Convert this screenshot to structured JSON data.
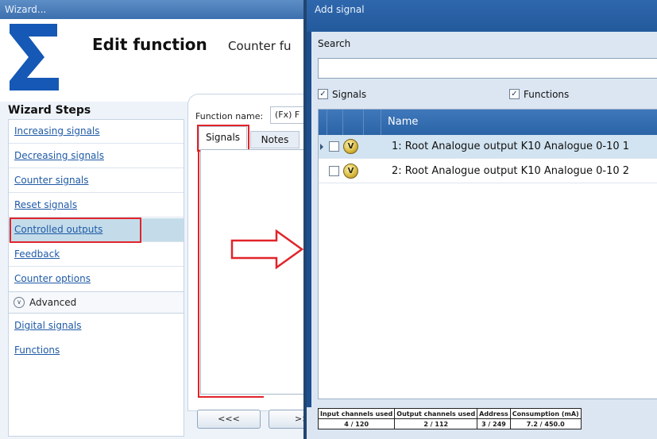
{
  "wizard": {
    "title": "Wizard...",
    "heading": "Edit function",
    "subheading": "Counter fu",
    "steps_title": "Wizard Steps",
    "steps": [
      {
        "label": "Increasing signals"
      },
      {
        "label": "Decreasing signals"
      },
      {
        "label": "Counter signals"
      },
      {
        "label": "Reset signals"
      },
      {
        "label": "Controlled outputs",
        "active": true
      },
      {
        "label": "Feedback"
      },
      {
        "label": "Counter options"
      }
    ],
    "advanced_label": "Advanced",
    "advanced_steps": [
      {
        "label": "Digital signals"
      },
      {
        "label": "Functions"
      }
    ],
    "function_name_label": "Function name:",
    "function_name_value": "(Fx) F",
    "tabs": [
      "Signals",
      "Notes"
    ],
    "nav": {
      "prev": "<<<",
      "next": ">>"
    }
  },
  "dialog": {
    "title": "Add signal",
    "search_label": "Search",
    "search_value": "",
    "filter_signals_label": "Signals",
    "filter_signals_checked": true,
    "filter_functions_label": "Functions",
    "filter_functions_checked": true,
    "column_name": "Name",
    "rows": [
      {
        "name": "1: Root Analogue output K10 Analogue 0-10 1",
        "icon": "V",
        "selected": true
      },
      {
        "name": "2: Root Analogue output K10 Analogue 0-10 2",
        "icon": "V",
        "selected": false
      }
    ],
    "status": {
      "input_label": "Input channels used",
      "input_value": "4 / 120",
      "output_label": "Output channels used",
      "output_value": "2 / 112",
      "address_label": "Address",
      "address_value": "3 / 249",
      "consumption_label": "Consumption (mA)",
      "consumption_value": "7.2 / 450.0"
    }
  },
  "colors": {
    "accent": "#2b64a6",
    "highlight_red": "#e1242a",
    "link": "#1f5aa6"
  }
}
